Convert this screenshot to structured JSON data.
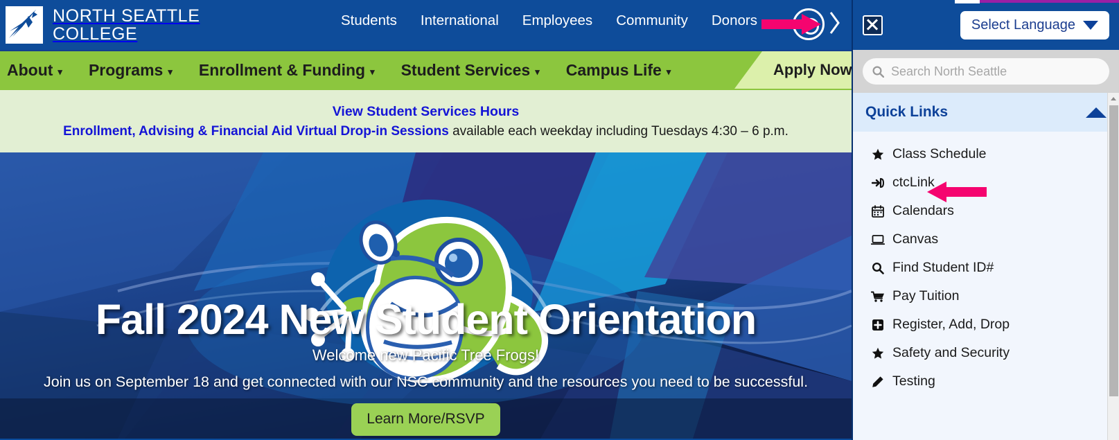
{
  "site": {
    "logo": {
      "line1": "NORTH SEATTLE",
      "line2": "COLLEGE",
      "icon": "star-burst-logo"
    },
    "top_nav": {
      "items": [
        {
          "label": "Students"
        },
        {
          "label": "International"
        },
        {
          "label": "Employees"
        },
        {
          "label": "Community"
        },
        {
          "label": "Donors"
        }
      ],
      "search_icon": "search-circle-icon",
      "expand_icon": "chevron-right-icon"
    },
    "main_nav": {
      "items": [
        {
          "label": "About",
          "caret": "▾"
        },
        {
          "label": "Programs",
          "caret": "▾"
        },
        {
          "label": "Enrollment & Funding",
          "caret": "▾"
        },
        {
          "label": "Student Services",
          "caret": "▾"
        },
        {
          "label": "Campus Life",
          "caret": "▾"
        }
      ],
      "apply_label": "Apply Now!"
    },
    "notice": {
      "line1_link": "View Student Services Hours",
      "line2_link": "Enrollment, Advising & Financial Aid Virtual Drop-in Sessions",
      "line2_rest": " available each weekday including Tuesdays 4:30 – 6 p.m."
    },
    "hero": {
      "title": "Fall 2024 New Student Orientation",
      "subtitle": "Welcome new Pacific Tree Frogs!",
      "description": "Join us on September 18 and get connected with our NSC community and the resources you need to be successful.",
      "cta_label": "Learn More/RSVP",
      "illustration": "pacific-tree-frog-illustration"
    }
  },
  "panel": {
    "close_label": "✕",
    "language_button": {
      "label": "Select Language",
      "icon": "chevron-down-icon"
    },
    "search": {
      "placeholder": "Search North Seattle",
      "value": "",
      "icon": "search-icon"
    },
    "quick_links": {
      "title": "Quick Links",
      "collapse_icon": "triangle-up-icon",
      "items": [
        {
          "label": "Class Schedule",
          "icon": "star-icon"
        },
        {
          "label": "ctcLink",
          "icon": "sign-in-icon"
        },
        {
          "label": "Calendars",
          "icon": "calendar-icon"
        },
        {
          "label": "Canvas",
          "icon": "desktop-icon"
        },
        {
          "label": "Find Student ID#",
          "icon": "search-icon"
        },
        {
          "label": "Pay Tuition",
          "icon": "shopping-cart-icon"
        },
        {
          "label": "Register, Add, Drop",
          "icon": "plus-square-icon"
        },
        {
          "label": "Safety and Security",
          "icon": "star-icon"
        },
        {
          "label": "Testing",
          "icon": "pencil-icon"
        }
      ]
    }
  },
  "annotations": [
    {
      "name": "pink-arrow-search",
      "target": "search-circle-icon",
      "color": "#f5046f"
    },
    {
      "name": "pink-arrow-ctclink",
      "target": "ctcLink",
      "color": "#f5046f"
    }
  ],
  "colors": {
    "brand_blue": "#0e4c9a",
    "nav_green": "#8cc63e",
    "apply_green": "#dcf0ab",
    "notice_green": "#e2efd3",
    "link_blue": "#1414d6",
    "panel_bg": "#f2f6fd",
    "quicklinks_header": "#dcebfb",
    "annotation_pink": "#f5046f",
    "accent_purple": "#9b1fa5"
  }
}
